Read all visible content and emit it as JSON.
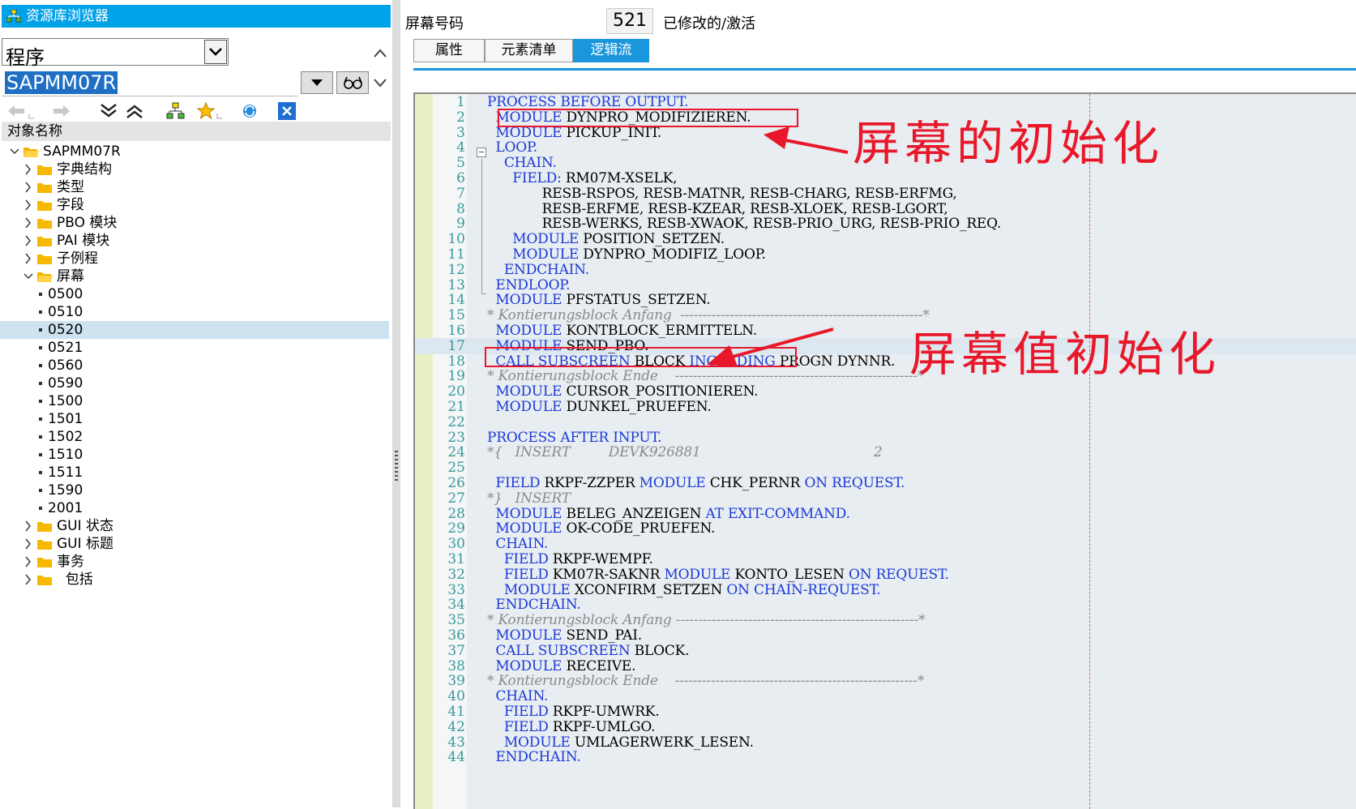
{
  "left": {
    "title": "资源库浏览器",
    "object_type": "程序",
    "object_name": "SAPMM07R",
    "column_header": "对象名称",
    "tree": [
      {
        "label": "SAPMM07R",
        "level": 0,
        "kind": "folder-open",
        "chev": "down"
      },
      {
        "label": "字典结构",
        "level": 1,
        "kind": "folder",
        "chev": "right"
      },
      {
        "label": "类型",
        "level": 1,
        "kind": "folder",
        "chev": "right"
      },
      {
        "label": "字段",
        "level": 1,
        "kind": "folder",
        "chev": "right"
      },
      {
        "label": "PBO 模块",
        "level": 1,
        "kind": "folder",
        "chev": "right"
      },
      {
        "label": "PAI 模块",
        "level": 1,
        "kind": "folder",
        "chev": "right"
      },
      {
        "label": "子例程",
        "level": 1,
        "kind": "folder",
        "chev": "right"
      },
      {
        "label": "屏幕",
        "level": 1,
        "kind": "folder-open",
        "chev": "down"
      },
      {
        "label": "0500",
        "level": 2,
        "kind": "leaf"
      },
      {
        "label": "0510",
        "level": 2,
        "kind": "leaf"
      },
      {
        "label": "0520",
        "level": 2,
        "kind": "leaf",
        "selected": true
      },
      {
        "label": "0521",
        "level": 2,
        "kind": "leaf"
      },
      {
        "label": "0560",
        "level": 2,
        "kind": "leaf"
      },
      {
        "label": "0590",
        "level": 2,
        "kind": "leaf"
      },
      {
        "label": "1500",
        "level": 2,
        "kind": "leaf"
      },
      {
        "label": "1501",
        "level": 2,
        "kind": "leaf"
      },
      {
        "label": "1502",
        "level": 2,
        "kind": "leaf"
      },
      {
        "label": "1510",
        "level": 2,
        "kind": "leaf"
      },
      {
        "label": "1511",
        "level": 2,
        "kind": "leaf"
      },
      {
        "label": "1590",
        "level": 2,
        "kind": "leaf"
      },
      {
        "label": "2001",
        "level": 2,
        "kind": "leaf"
      },
      {
        "label": "GUI 状态",
        "level": 1,
        "kind": "folder",
        "chev": "right"
      },
      {
        "label": "GUI 标题",
        "level": 1,
        "kind": "folder",
        "chev": "right"
      },
      {
        "label": "事务",
        "level": 1,
        "kind": "folder",
        "chev": "right"
      },
      {
        "label": "  包括",
        "level": 1,
        "kind": "folder",
        "chev": "right"
      }
    ],
    "toolbar_icons": [
      "back-arrow-icon",
      "forward-arrow-icon",
      "collapse-all-icon",
      "expand-all-icon",
      "hierarchy-icon",
      "favorite-star-icon",
      "refresh-icon",
      "close-icon"
    ]
  },
  "right": {
    "screen_number_label": "屏幕号码",
    "screen_number": "521",
    "status": "已修改的/激活",
    "tabs": [
      {
        "label": "属性",
        "active": false
      },
      {
        "label": "元素清单",
        "active": false
      },
      {
        "label": "逻辑流",
        "active": true
      }
    ],
    "annotations": {
      "init": "屏幕的初始化",
      "value_init": "屏幕值初始化"
    },
    "code": [
      [
        [
          "k",
          "PROCESS BEFORE OUTPUT."
        ]
      ],
      [
        [
          "t",
          "  "
        ],
        [
          "k",
          "MODULE"
        ],
        [
          "t",
          " DYNPRO_MODIFIZIEREN."
        ]
      ],
      [
        [
          "t",
          "  "
        ],
        [
          "k",
          "MODULE"
        ],
        [
          "t",
          " PICKUP_INIT."
        ]
      ],
      [
        [
          "t",
          "  "
        ],
        [
          "k",
          "LOOP."
        ]
      ],
      [
        [
          "t",
          "    "
        ],
        [
          "k",
          "CHAIN."
        ]
      ],
      [
        [
          "t",
          "      "
        ],
        [
          "k",
          "FIELD:"
        ],
        [
          "t",
          " RM07M-XSELK,"
        ]
      ],
      [
        [
          "t",
          "             RESB-RSPOS, RESB-MATNR, RESB-CHARG, RESB-ERFMG,"
        ]
      ],
      [
        [
          "t",
          "             RESB-ERFME, RESB-KZEAR, RESB-XLOEK, RESB-LGORT,"
        ]
      ],
      [
        [
          "t",
          "             RESB-WERKS, RESB-XWAOK, RESB-PRIO_URG, RESB-PRIO_REQ."
        ]
      ],
      [
        [
          "t",
          "      "
        ],
        [
          "k",
          "MODULE"
        ],
        [
          "t",
          " POSITION_SETZEN."
        ]
      ],
      [
        [
          "t",
          "      "
        ],
        [
          "k",
          "MODULE"
        ],
        [
          "t",
          " DYNPRO_MODIFIZ_LOOP."
        ]
      ],
      [
        [
          "t",
          "    "
        ],
        [
          "k",
          "ENDCHAIN."
        ]
      ],
      [
        [
          "t",
          "  "
        ],
        [
          "k",
          "ENDLOOP."
        ]
      ],
      [
        [
          "t",
          "  "
        ],
        [
          "k",
          "MODULE"
        ],
        [
          "t",
          " PFSTATUS_SETZEN."
        ]
      ],
      [
        [
          "c",
          "* Kontierungsblock Anfang  ------------------------------------------------------*"
        ]
      ],
      [
        [
          "t",
          "  "
        ],
        [
          "k",
          "MODULE"
        ],
        [
          "t",
          " KONTBLOCK_ERMITTELN."
        ]
      ],
      [
        [
          "t",
          "  "
        ],
        [
          "k",
          "MODULE"
        ],
        [
          "t",
          " SEND_PBO."
        ]
      ],
      [
        [
          "t",
          "  "
        ],
        [
          "k",
          "CALL SUBSCREEN"
        ],
        [
          "t",
          " BLOCK "
        ],
        [
          "k",
          "INCLUDING"
        ],
        [
          "t",
          " PROGN DYNNR."
        ]
      ],
      [
        [
          "c",
          "* Kontierungsblock Ende    ------------------------------------------------------*"
        ]
      ],
      [
        [
          "t",
          "  "
        ],
        [
          "k",
          "MODULE"
        ],
        [
          "t",
          " CURSOR_POSITIONIEREN."
        ]
      ],
      [
        [
          "t",
          "  "
        ],
        [
          "k",
          "MODULE"
        ],
        [
          "t",
          " DUNKEL_PRUEFEN."
        ]
      ],
      [
        [
          "t",
          ""
        ]
      ],
      [
        [
          "k",
          "PROCESS AFTER INPUT."
        ]
      ],
      [
        [
          "c",
          "*{   INSERT         DEVK926881                                         2"
        ]
      ],
      [
        [
          "t",
          ""
        ]
      ],
      [
        [
          "t",
          "  "
        ],
        [
          "k",
          "FIELD"
        ],
        [
          "t",
          " RKPF-ZZPER "
        ],
        [
          "k",
          "MODULE"
        ],
        [
          "t",
          " CHK_PERNR "
        ],
        [
          "k",
          "ON REQUEST."
        ]
      ],
      [
        [
          "c",
          "*}   INSERT"
        ]
      ],
      [
        [
          "t",
          "  "
        ],
        [
          "k",
          "MODULE"
        ],
        [
          "t",
          " BELEG_ANZEIGEN "
        ],
        [
          "k",
          "AT EXIT-COMMAND."
        ]
      ],
      [
        [
          "t",
          "  "
        ],
        [
          "k",
          "MODULE"
        ],
        [
          "t",
          " OK-CODE_PRUEFEN."
        ]
      ],
      [
        [
          "t",
          "  "
        ],
        [
          "k",
          "CHAIN."
        ]
      ],
      [
        [
          "t",
          "    "
        ],
        [
          "k",
          "FIELD"
        ],
        [
          "t",
          " RKPF-WEMPF."
        ]
      ],
      [
        [
          "t",
          "    "
        ],
        [
          "k",
          "FIELD"
        ],
        [
          "t",
          " KM07R-SAKNR "
        ],
        [
          "k",
          "MODULE"
        ],
        [
          "t",
          " KONTO_LESEN "
        ],
        [
          "k",
          "ON REQUEST."
        ]
      ],
      [
        [
          "t",
          "    "
        ],
        [
          "k",
          "MODULE"
        ],
        [
          "t",
          " XCONFIRM_SETZEN "
        ],
        [
          "k",
          "ON CHAIN-REQUEST."
        ]
      ],
      [
        [
          "t",
          "  "
        ],
        [
          "k",
          "ENDCHAIN."
        ]
      ],
      [
        [
          "c",
          "* Kontierungsblock Anfang ------------------------------------------------------*"
        ]
      ],
      [
        [
          "t",
          "  "
        ],
        [
          "k",
          "MODULE"
        ],
        [
          "t",
          " SEND_PAI."
        ]
      ],
      [
        [
          "t",
          "  "
        ],
        [
          "k",
          "CALL SUBSCREEN"
        ],
        [
          "t",
          " BLOCK."
        ]
      ],
      [
        [
          "t",
          "  "
        ],
        [
          "k",
          "MODULE"
        ],
        [
          "t",
          " RECEIVE."
        ]
      ],
      [
        [
          "c",
          "* Kontierungsblock Ende    ------------------------------------------------------*"
        ]
      ],
      [
        [
          "t",
          "  "
        ],
        [
          "k",
          "CHAIN."
        ]
      ],
      [
        [
          "t",
          "    "
        ],
        [
          "k",
          "FIELD"
        ],
        [
          "t",
          " RKPF-UMWRK."
        ]
      ],
      [
        [
          "t",
          "    "
        ],
        [
          "k",
          "FIELD"
        ],
        [
          "t",
          " RKPF-UMLGO."
        ]
      ],
      [
        [
          "t",
          "    "
        ],
        [
          "k",
          "MODULE"
        ],
        [
          "t",
          " UMLAGERWERK_LESEN."
        ]
      ],
      [
        [
          "t",
          "  "
        ],
        [
          "k",
          "ENDCHAIN."
        ]
      ]
    ],
    "current_line": 17,
    "colors": {
      "keyword": "#1a3ad8",
      "comment": "#8a8a8a",
      "accent": "#1a96dc",
      "annotation": "#e8182a"
    }
  }
}
